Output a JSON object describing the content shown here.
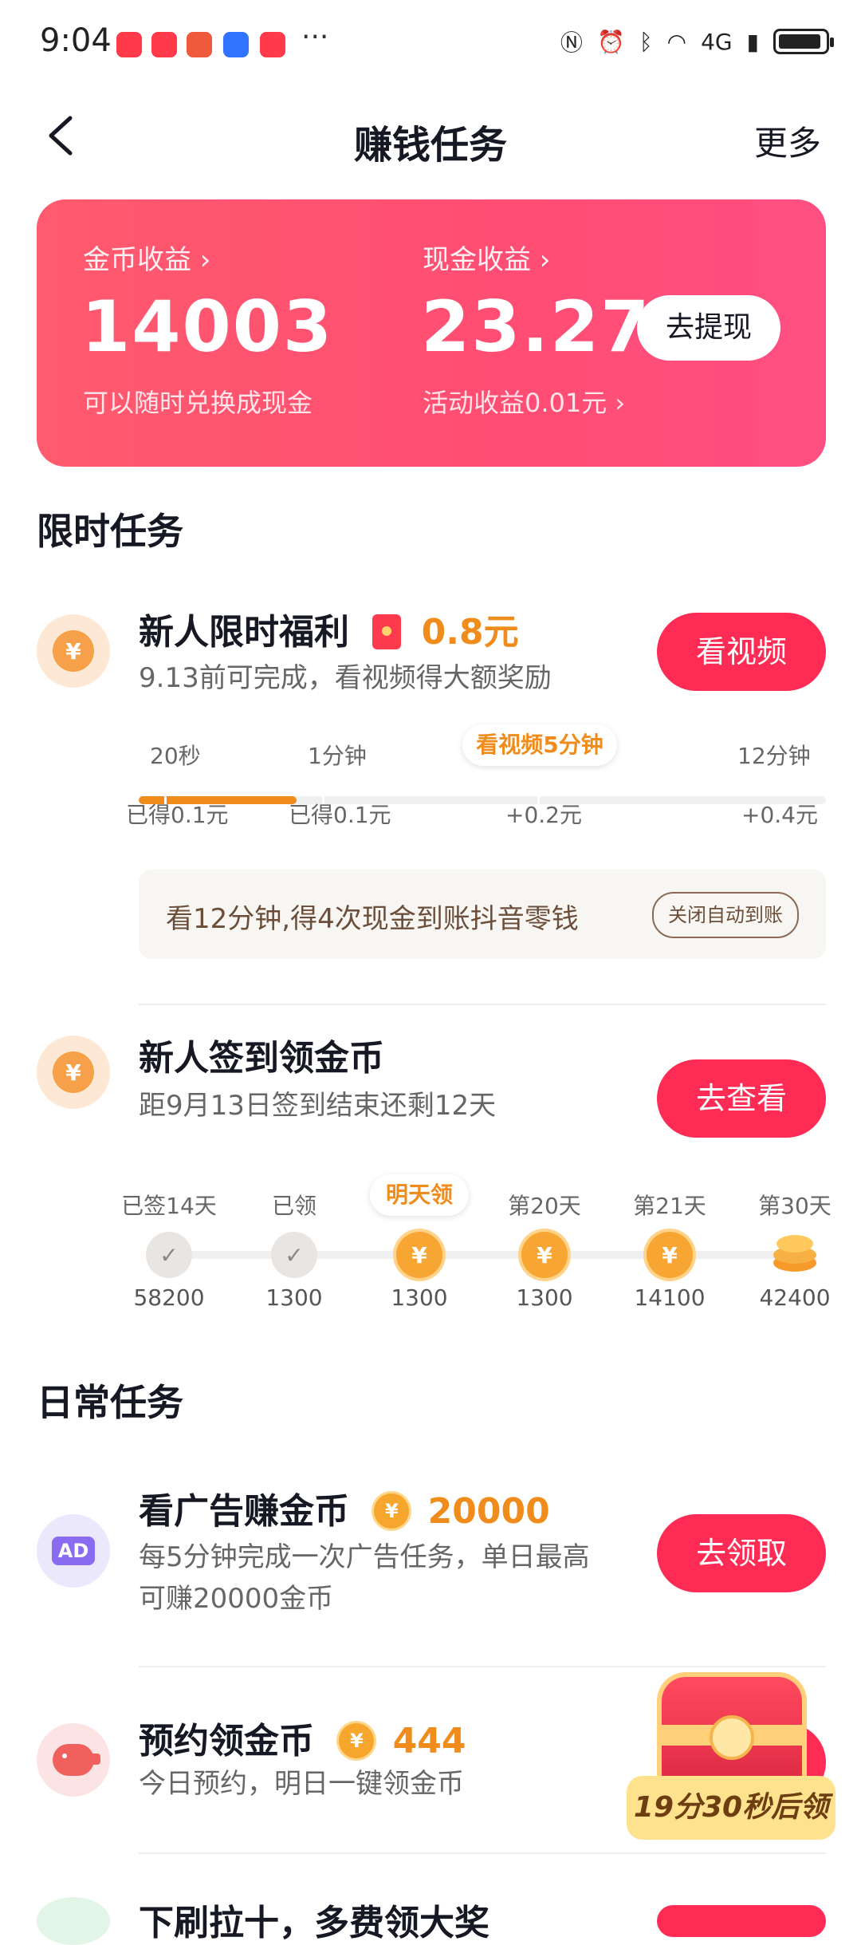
{
  "status_bar": {
    "time": "9:04",
    "more_dots": "···",
    "network": "4G"
  },
  "nav": {
    "title": "赚钱任务",
    "more": "更多"
  },
  "earnings": {
    "coin_label": "金币收益 ›",
    "coin_value": "14003",
    "coin_sub": "可以随时兑换成现金",
    "cash_label": "现金收益 ›",
    "cash_value": "23.27",
    "cash_sub": "活动收益0.01元 ›",
    "withdraw_button": "去提现"
  },
  "sections": {
    "limited": "限时任务",
    "daily": "日常任务"
  },
  "newbie_bonus": {
    "title": "新人限时福利",
    "amount": "0.8元",
    "desc": "9.13前可完成，看视频得大额奖励",
    "button": "看视频",
    "progress_fraction": 0.23,
    "milestones": [
      {
        "top": "20秒",
        "bottom": "已得0.1元"
      },
      {
        "top": "1分钟",
        "bottom": "已得0.1元"
      },
      {
        "top": "看视频5分钟",
        "bottom": "+0.2元"
      },
      {
        "top": "12分钟",
        "bottom": "+0.4元"
      }
    ],
    "tip": "看12分钟,得4次现金到账抖音零钱",
    "tip_button": "关闭自动到账"
  },
  "checkin": {
    "title": "新人签到领金币",
    "desc": "距9月13日签到结束还剩12天",
    "button": "去查看",
    "days": [
      {
        "label": "已签14天",
        "value": "58200",
        "state": "done"
      },
      {
        "label": "已领",
        "value": "1300",
        "state": "done"
      },
      {
        "label": "明天领",
        "value": "1300",
        "state": "next"
      },
      {
        "label": "第20天",
        "value": "1300",
        "state": "coin"
      },
      {
        "label": "第21天",
        "value": "14100",
        "state": "coin"
      },
      {
        "label": "第30天",
        "value": "42400",
        "state": "stack"
      }
    ]
  },
  "ads_task": {
    "icon_text": "AD",
    "title": "看广告赚金币",
    "amount": "20000",
    "desc_line1": "每5分钟完成一次广告任务，单日最高",
    "desc_line2": "可赚20000金币",
    "button": "去领取"
  },
  "reserve_task": {
    "title": "预约领金币",
    "amount": "444",
    "desc": "今日预约，明日一键领金币"
  },
  "partial_task": {
    "title": "下刷拉十，多费领大奖"
  },
  "floater": {
    "timer": "19分30秒后领"
  },
  "colors": {
    "accent": "#fe2c55",
    "orange": "#f08c1b",
    "card_gradient_start": "#ff5a6e"
  }
}
